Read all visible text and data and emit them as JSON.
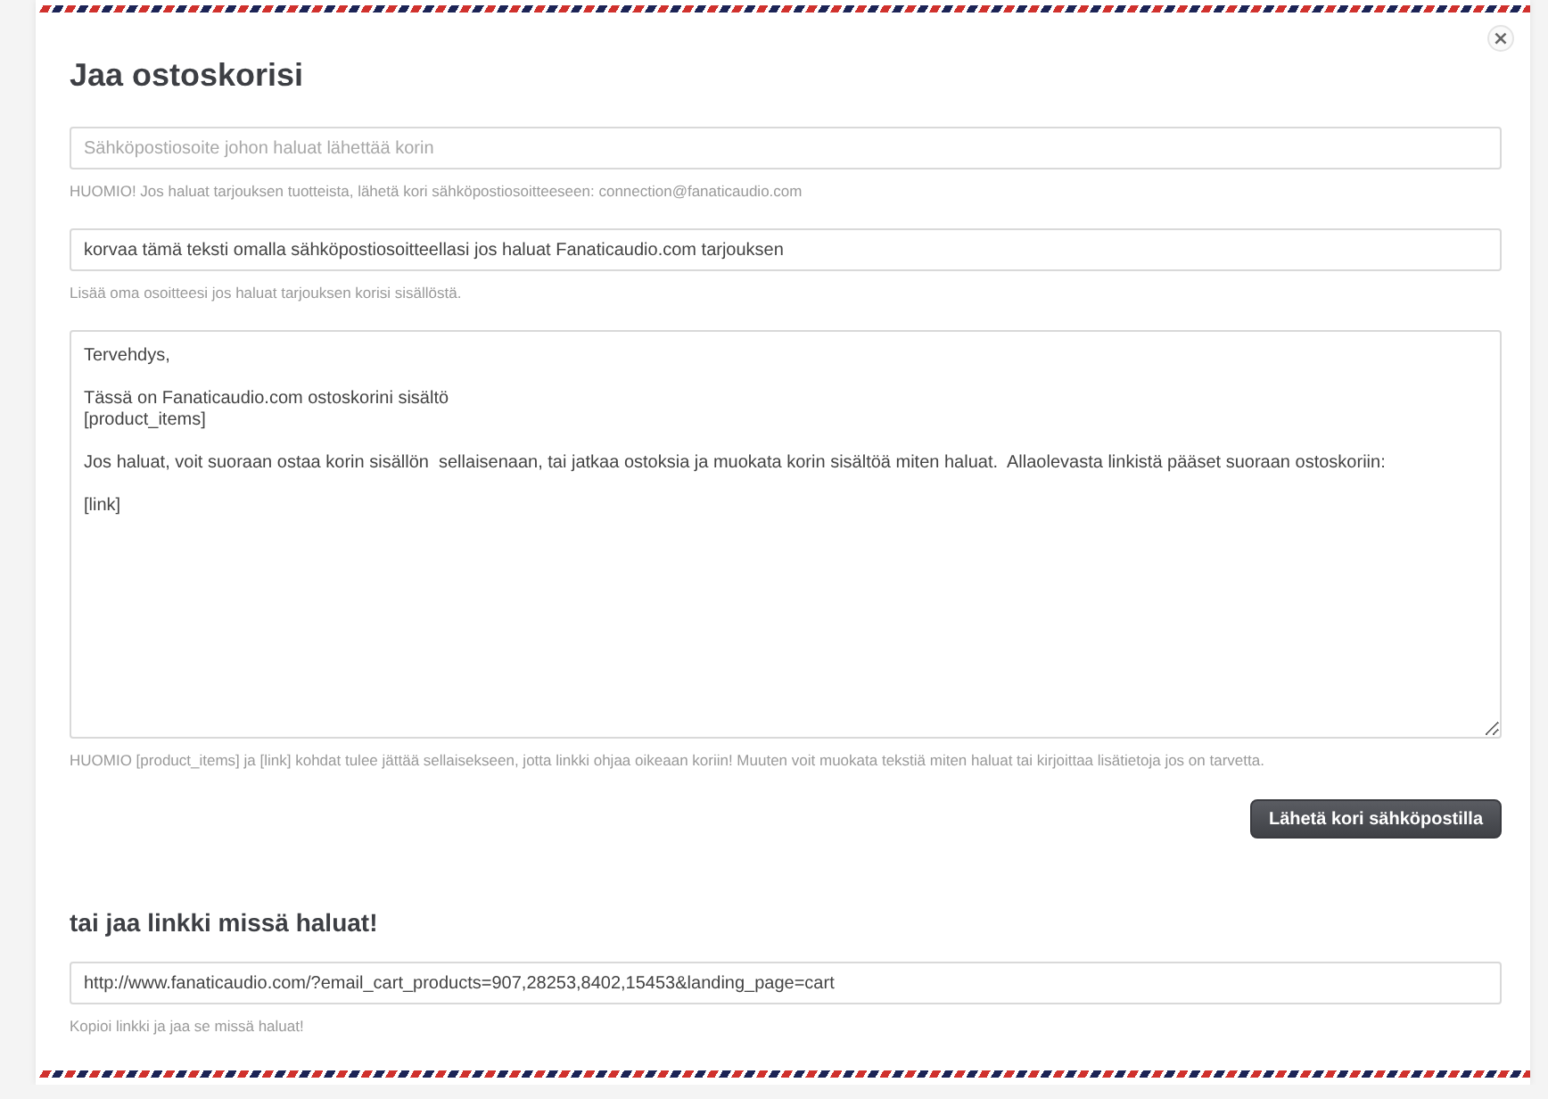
{
  "dialog": {
    "title": "Jaa ostoskorisi",
    "close_label": "×"
  },
  "email_form": {
    "fields": [
      {
        "kind": "input",
        "placeholder": "Sähköpostiosoite johon haluat lähettää korin",
        "help": "HUOMIO! Jos haluat tarjouksen tuotteista, lähetä kori sähköpostiosoitteeseen: connection@fanaticaudio.com"
      },
      {
        "kind": "input",
        "value": "korvaa tämä teksti omalla sähköpostiosoitteellasi jos haluat Fanaticaudio.com tarjouksen",
        "help": "Lisää oma osoitteesi jos haluat tarjouksen korisi sisällöstä."
      },
      {
        "kind": "textarea",
        "value": "Tervehdys,\n\nTässä on Fanaticaudio.com ostoskorini sisältö\n[product_items]\n\nJos haluat, voit suoraan ostaa korin sisällön  sellaisenaan, tai jatkaa ostoksia ja muokata korin sisältöä miten haluat.  Allaolevasta linkistä pääset suoraan ostoskoriin:\n\n[link]",
        "help": "HUOMIO [product_items] ja [link] kohdat tulee jättää sellaisekseen, jotta linkki ohjaa oikeaan koriin! Muuten voit muokata tekstiä miten haluat tai kirjoittaa lisätietoja jos on tarvetta."
      }
    ],
    "submit_button": "Lähetä kori sähköpostilla"
  },
  "link_share": {
    "heading": "tai jaa linkki missä haluat!",
    "field": {
      "kind": "input",
      "value": "http://www.fanaticaudio.com/?email_cart_products=907,28253,8402,15453&landing_page=cart",
      "help": "Kopioi linkki ja jaa se missä haluat!"
    }
  }
}
